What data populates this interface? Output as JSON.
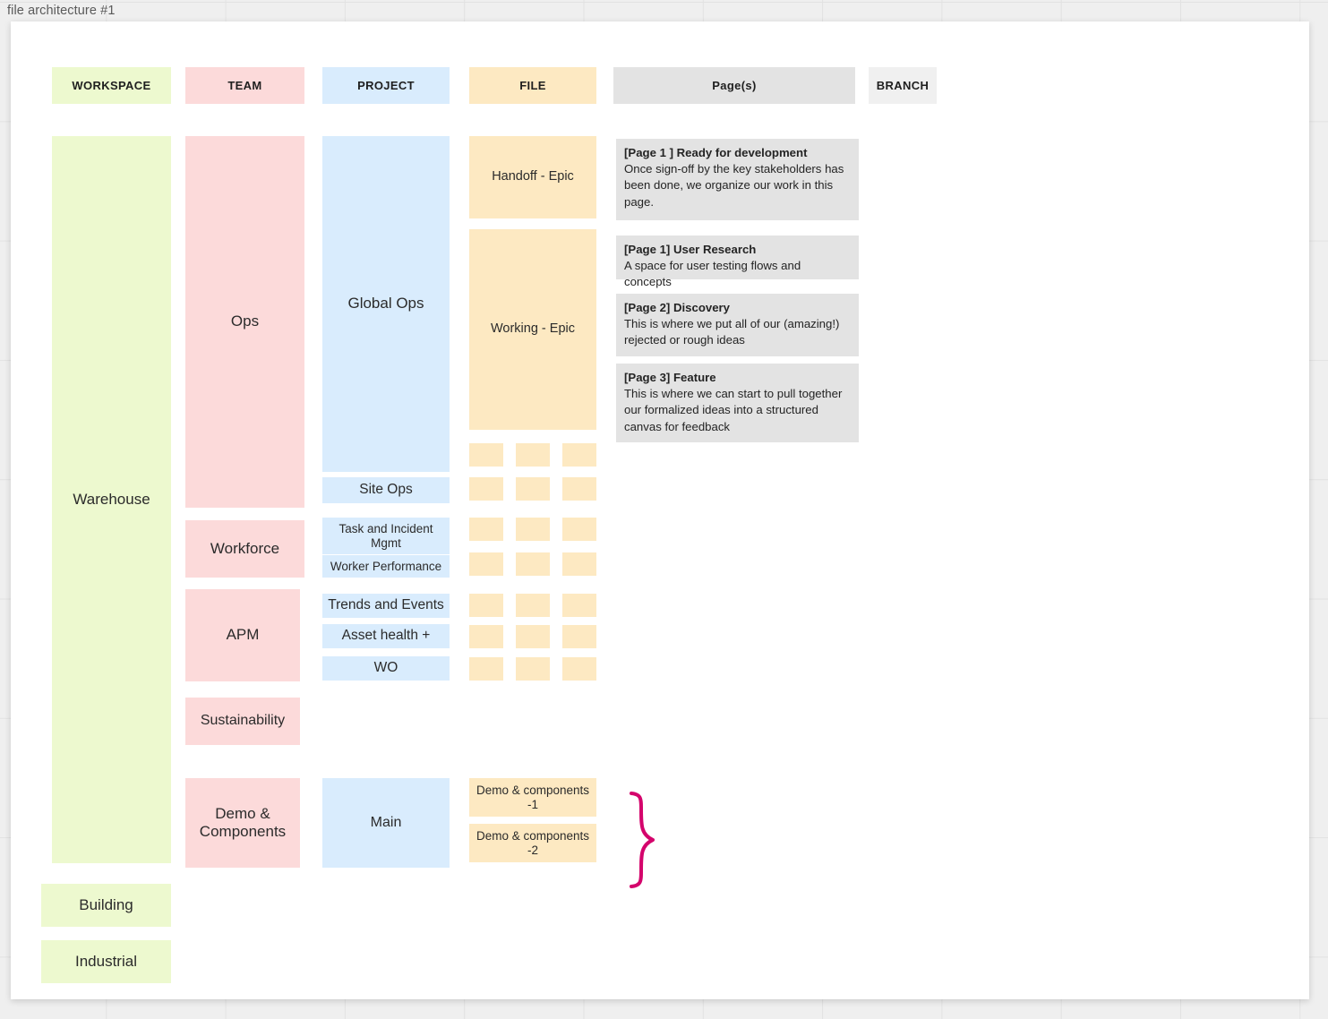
{
  "board": {
    "title": "file architecture #1"
  },
  "columns": [
    {
      "key": "workspace",
      "label": "WORKSPACE"
    },
    {
      "key": "team",
      "label": "TEAM"
    },
    {
      "key": "project",
      "label": "PROJECT"
    },
    {
      "key": "file",
      "label": "FILE"
    },
    {
      "key": "pages",
      "label": "Page(s)"
    },
    {
      "key": "branch",
      "label": "BRANCH"
    }
  ],
  "workspaces": [
    {
      "label": "Warehouse"
    },
    {
      "label": "Building"
    },
    {
      "label": "Industrial"
    }
  ],
  "teams": [
    {
      "label": "Ops"
    },
    {
      "label": "Workforce"
    },
    {
      "label": "APM"
    },
    {
      "label": "Sustainability"
    },
    {
      "label": "Demo &\nComponents"
    }
  ],
  "projects": [
    {
      "label": "Global Ops"
    },
    {
      "label": "Site Ops"
    },
    {
      "label": "Task and Incident Mgmt"
    },
    {
      "label": "Worker Performance"
    },
    {
      "label": "Trends and Events"
    },
    {
      "label": "Asset health +"
    },
    {
      "label": "WO"
    },
    {
      "label": "Main"
    }
  ],
  "files": [
    {
      "label": "Handoff - Epic"
    },
    {
      "label": "Working - Epic"
    },
    {
      "label": "Demo & components -1"
    },
    {
      "label": "Demo & components -2"
    }
  ],
  "file_chips": {
    "rows": 7,
    "cols": 3,
    "count": 21
  },
  "pages": [
    {
      "title": "[Page 1 ] Ready for development",
      "body": "Once sign-off by the key stakeholders has been done, we organize our work in this page."
    },
    {
      "title": "[Page 1] User Research",
      "body": "A space for user testing flows and concepts"
    },
    {
      "title": "[Page 2] Discovery",
      "body": "This is where we put all of our (amazing!) rejected or rough ideas"
    },
    {
      "title": "[Page 3] Feature",
      "body": "This is where we can start to pull together our formalized ideas into a structured canvas for feedback"
    }
  ],
  "colors": {
    "workspace": "#edf9cf",
    "team": "#fcdada",
    "project": "#d9ecfd",
    "file": "#fde9c2",
    "pages": "#e3e3e3",
    "branch": "#f0f0f0",
    "brace": "#d4046c",
    "canvas": "#efefef",
    "card": "#ffffff"
  }
}
